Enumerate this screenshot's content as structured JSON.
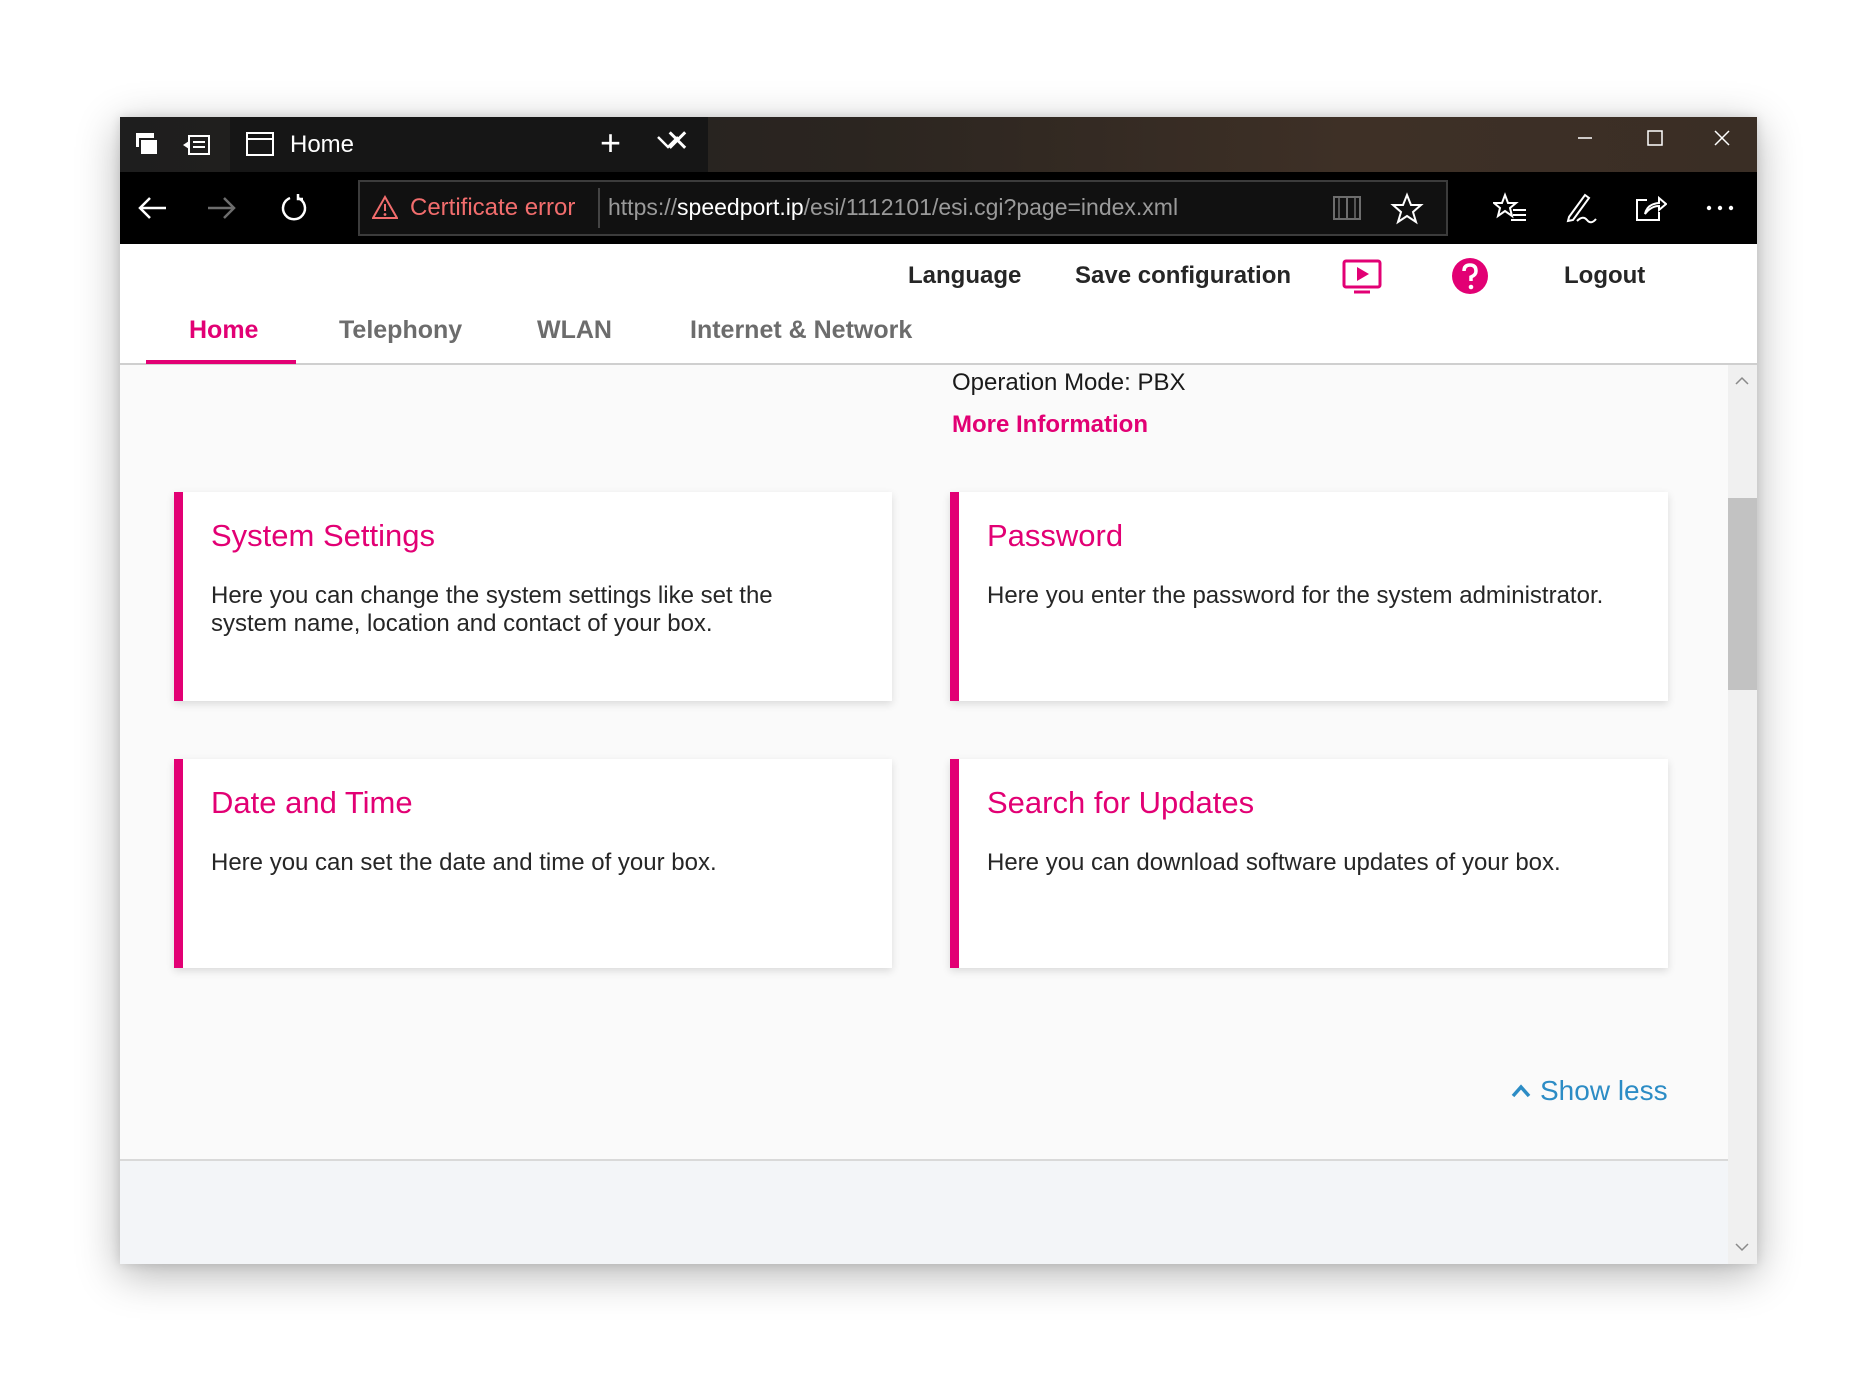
{
  "browser": {
    "tab_title": "Home",
    "cert_error": "Certificate error",
    "url_scheme": "https://",
    "url_host": "speedport.ip",
    "url_path": "/esi/1112101/esi.cgi?page=index.xml"
  },
  "header": {
    "language": "Language",
    "save_configuration": "Save configuration",
    "logout": "Logout",
    "nav": [
      "Home",
      "Telephony",
      "WLAN",
      "Internet & Network"
    ],
    "active_nav": "Home"
  },
  "main": {
    "operation_mode": "Operation Mode: PBX",
    "more_information": "More Information",
    "cards": [
      {
        "title": "System Settings",
        "text": "Here you can change the system settings like set the system name, location and contact of your box."
      },
      {
        "title": "Password",
        "text": "Here you enter the password for the system administrator."
      },
      {
        "title": "Date and Time",
        "text": "Here you can set the date and time of your box."
      },
      {
        "title": "Search for Updates",
        "text": "Here you can download software updates of your box."
      }
    ],
    "show_less": "Show less"
  },
  "colors": {
    "accent": "#e20074",
    "link_blue": "#2c8cc5",
    "cert_error": "#f26d6d"
  }
}
